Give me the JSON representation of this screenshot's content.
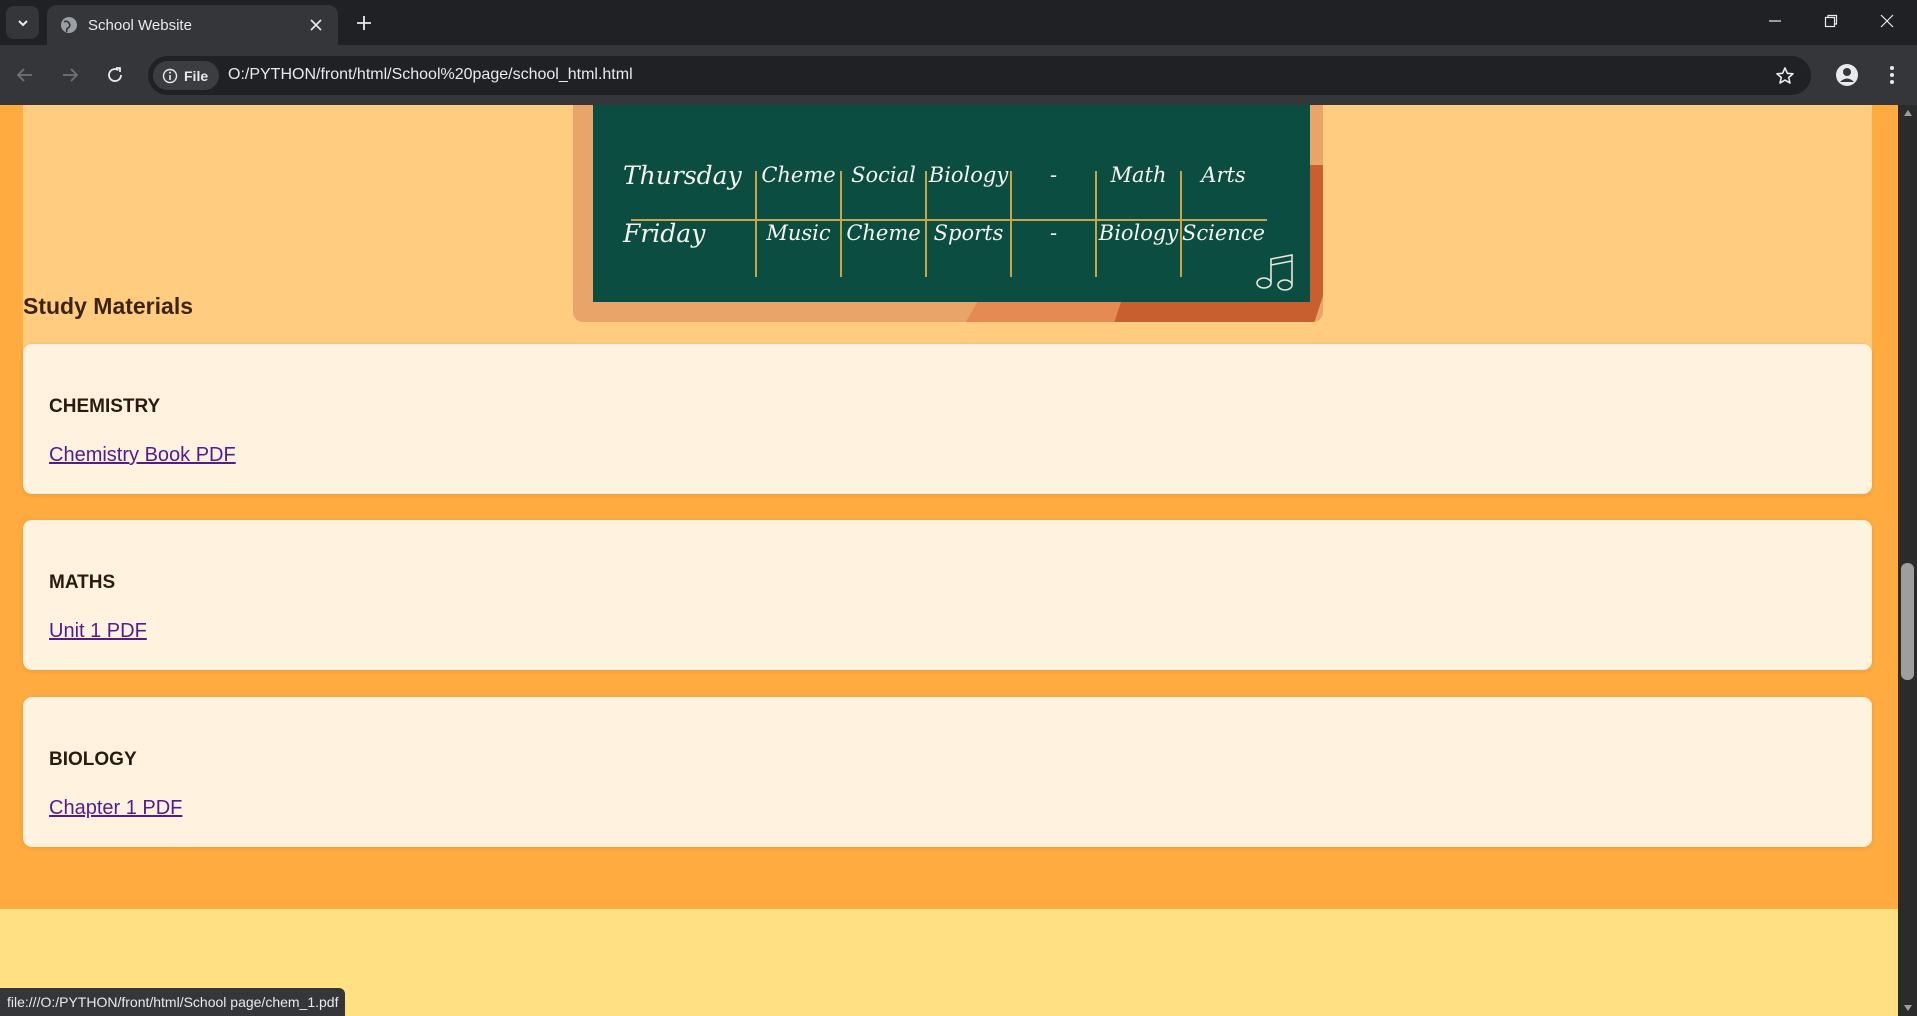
{
  "browser": {
    "tab_title": "School Website",
    "chip_label": "File",
    "url": "O:/PYTHON/front/html/School%20page/school_html.html",
    "status_url": "file:///O:/PYTHON/front/html/School page/chem_1.pdf",
    "icons": [
      "tab-search-icon",
      "globe-icon",
      "close-icon",
      "plus-icon",
      "minimize-icon",
      "restore-icon",
      "close-window-icon",
      "back-arrow-icon",
      "forward-arrow-icon",
      "reload-icon",
      "info-icon",
      "star-icon",
      "profile-icon",
      "more-vertical-icon"
    ]
  },
  "timetable": {
    "rows": [
      {
        "day": "Thursday",
        "cells": [
          "Cheme",
          "Social",
          "Biology",
          "-",
          "Math",
          "Arts"
        ]
      },
      {
        "day": "Friday",
        "cells": [
          "Music",
          "Cheme",
          "Sports",
          "-",
          "Biology",
          "Science"
        ]
      }
    ]
  },
  "study_materials": {
    "heading": "Study Materials",
    "subjects": [
      {
        "title": "CHEMISTRY",
        "link": "Chemistry Book PDF"
      },
      {
        "title": "MATHS",
        "link": "Unit 1 PDF"
      },
      {
        "title": "BIOLOGY",
        "link": "Chapter 1 PDF"
      }
    ]
  },
  "colors": {
    "page_bg": "#ffab40",
    "card_bg": "#fff3e0",
    "board": "#0b4d40",
    "footer": "#ffe082",
    "link": "#551a8b"
  }
}
